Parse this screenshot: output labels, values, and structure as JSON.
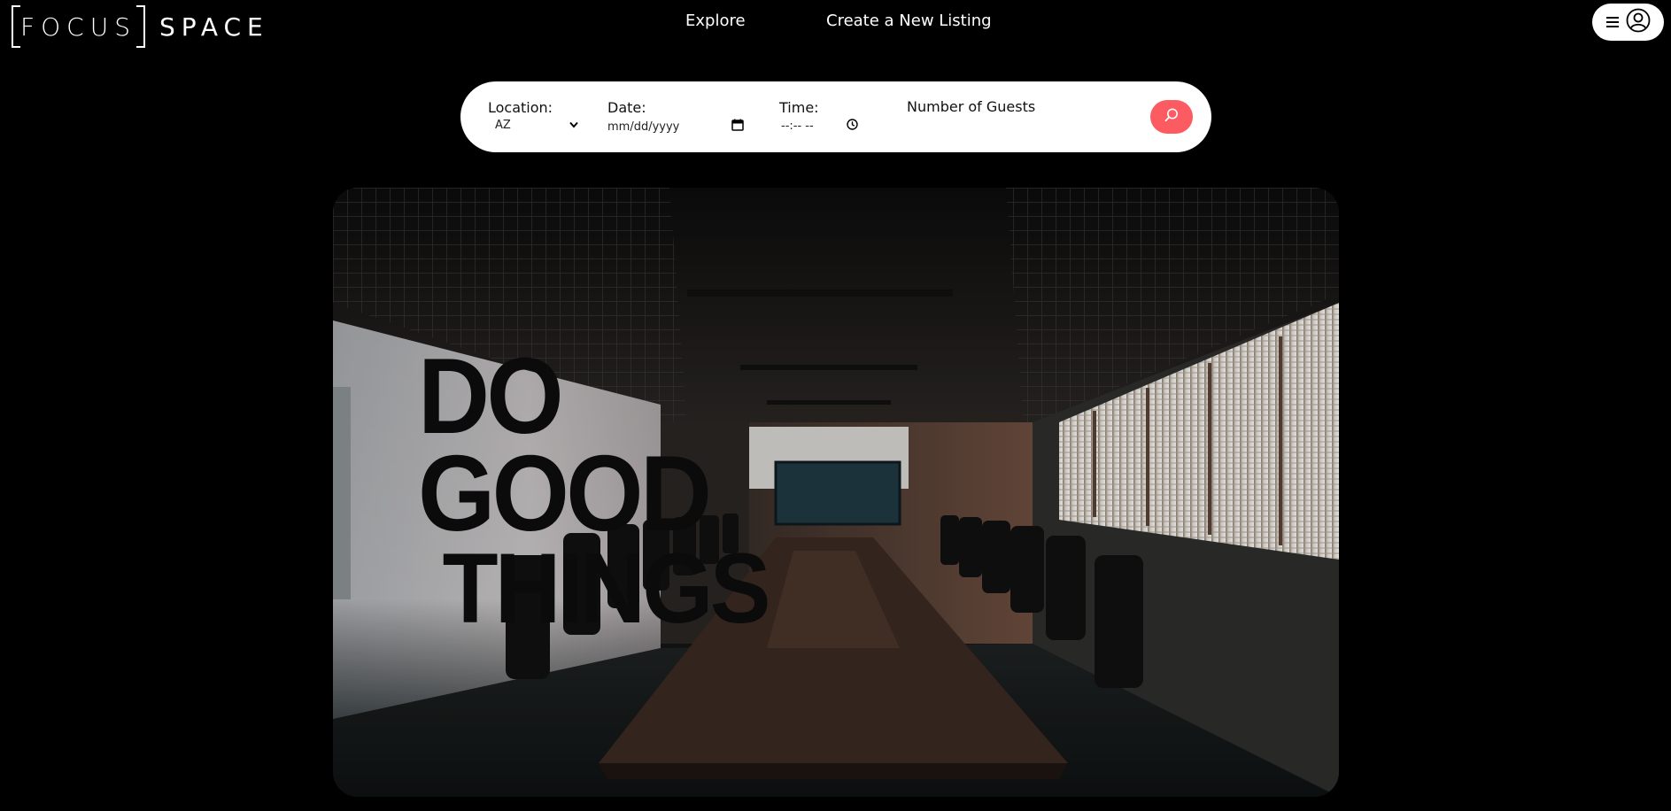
{
  "brand": {
    "logo_part1": "FOCUS",
    "logo_part2": "SPACE"
  },
  "nav": {
    "explore": "Explore",
    "create_listing": "Create a New Listing"
  },
  "user_menu": {
    "icons": [
      "hamburger-icon",
      "user-avatar-icon"
    ]
  },
  "search": {
    "location_label": "Location:",
    "location_value": "AZ",
    "date_label": "Date:",
    "date_placeholder": "mm/dd/yyyy",
    "time_label": "Time:",
    "time_placeholder": "--:-- --",
    "guests_label": "Number of Guests",
    "button_icon": "search-icon"
  },
  "hero": {
    "wall_text": [
      "DO",
      "GOOD",
      "THINGS"
    ]
  },
  "colors": {
    "background": "#000000",
    "search_button": "#fc5b62",
    "search_bar": "#ffffff"
  }
}
